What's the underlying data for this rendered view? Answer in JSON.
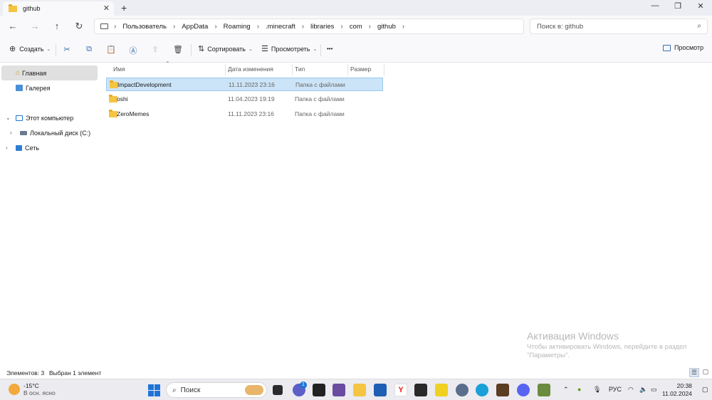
{
  "window": {
    "tab_title": "github",
    "tab_close": "✕",
    "new_tab": "+",
    "minimize": "—",
    "maximize": "❐",
    "close": "✕"
  },
  "nav": {
    "back": "←",
    "forward": "→",
    "up": "↑",
    "refresh": "↻",
    "breadcrumb": [
      "Пользователь",
      "AppData",
      "Roaming",
      ".minecraft",
      "libraries",
      "com",
      "github"
    ],
    "search_placeholder": "Поиск в: github"
  },
  "toolbar": {
    "create_label": "Создать",
    "sort_label": "Сортировать",
    "view_label": "Просмотреть",
    "more": "•••",
    "preview_label": "Просмотр"
  },
  "sidebar": {
    "items": [
      {
        "label": "Главная"
      },
      {
        "label": "Галерея"
      },
      {
        "label": "Этот компьютер"
      },
      {
        "label": "Локальный диск (C:)"
      },
      {
        "label": "Сеть"
      }
    ]
  },
  "files": {
    "columns": [
      "Имя",
      "Дата изменения",
      "Тип",
      "Размер"
    ],
    "rows": [
      {
        "name": "ImpactDevelopment",
        "date": "11.11.2023 23:16",
        "type": "Папка с файлами",
        "selected": true
      },
      {
        "name": "oshi",
        "date": "11.04.2023 19:19",
        "type": "Папка с файлами",
        "selected": false
      },
      {
        "name": "ZeroMemes",
        "date": "11.11.2023 23:16",
        "type": "Папка с файлами",
        "selected": false
      }
    ]
  },
  "watermark": {
    "title": "Активация Windows",
    "text": "Чтобы активировать Windows, перейдите в раздел \"Параметры\"."
  },
  "status": {
    "items_count": "Элементов: 3",
    "selected": "Выбран 1 элемент"
  },
  "taskbar": {
    "weather_temp": "-15°C",
    "weather_desc": "В осн. ясно",
    "search_label": "Поиск",
    "notification_badge": "1",
    "language": "РУС",
    "time": "20:38",
    "date": "11.02.2024"
  },
  "colors": {
    "selection": "#cce4f7",
    "accent": "#1e74d6",
    "folder": "#f5c542"
  }
}
